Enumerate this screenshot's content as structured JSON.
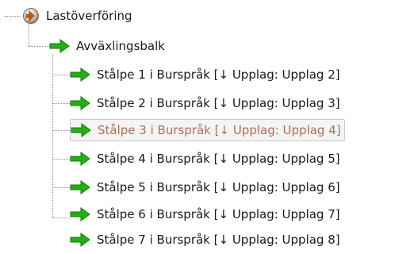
{
  "tree": {
    "root": {
      "label": "Lastöverföring",
      "icon": "load-transfer-icon"
    },
    "child": {
      "label": "Avväxlingsbalk",
      "icon": "green-arrow-icon"
    },
    "items": [
      {
        "label": "Stålpe 1 i Burspråk  [↓ Upplag: Upplag 2]",
        "icon": "green-arrow-icon",
        "selected": false
      },
      {
        "label": "Stålpe 2 i Burspråk  [↓ Upplag: Upplag 3]",
        "icon": "green-arrow-icon",
        "selected": false
      },
      {
        "label": "Stålpe 3 i Burspråk  [↓ Upplag: Upplag 4]",
        "icon": "green-arrow-icon",
        "selected": true
      },
      {
        "label": "Stålpe 4 i Burspråk  [↓ Upplag: Upplag 5]",
        "icon": "green-arrow-icon",
        "selected": false
      },
      {
        "label": "Stålpe 5 i Burspråk  [↓ Upplag: Upplag 6]",
        "icon": "green-arrow-icon",
        "selected": false
      },
      {
        "label": "Stålpe 6 i Burspråk  [↓ Upplag: Upplag 7]",
        "icon": "green-arrow-icon",
        "selected": false
      },
      {
        "label": "Stålpe 7 i Burspråk  [↓ Upplag: Upplag 8]",
        "icon": "green-arrow-icon",
        "selected": false
      }
    ]
  },
  "colors": {
    "arrow_fill": "#22b014",
    "arrow_stroke": "#137a0a",
    "selected_text": "#b07050",
    "connector": "#8a8a8a"
  }
}
